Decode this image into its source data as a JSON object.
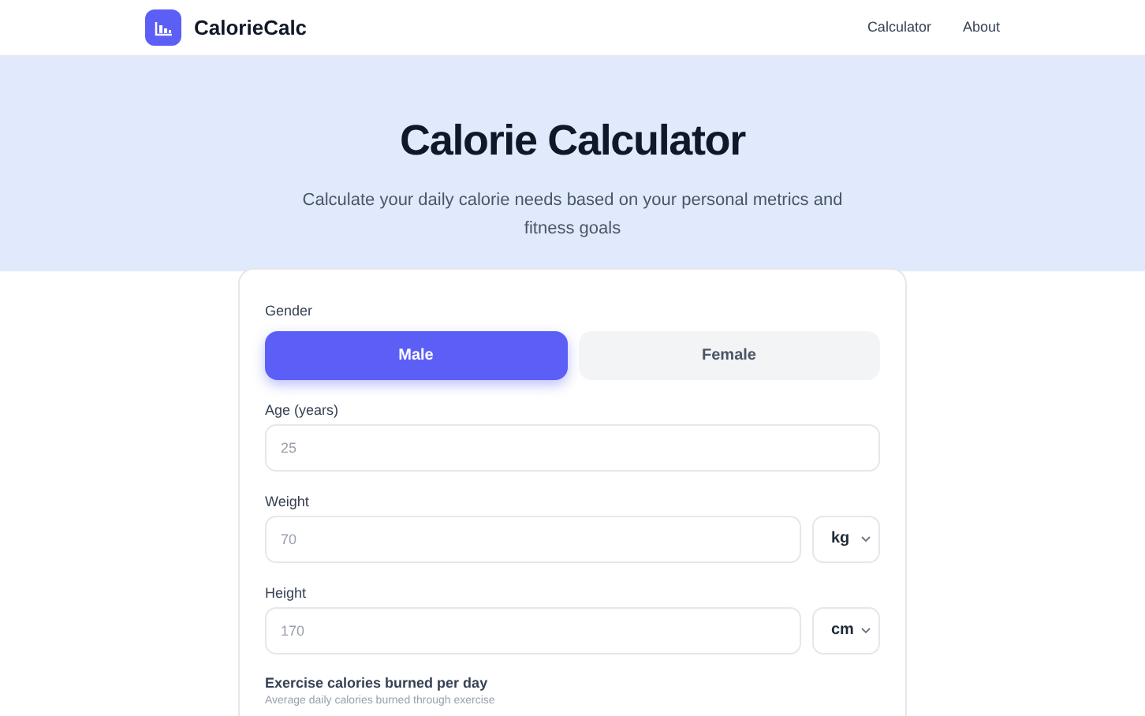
{
  "header": {
    "brand": "CalorieCalc",
    "nav": [
      {
        "label": "Calculator"
      },
      {
        "label": "About"
      }
    ]
  },
  "hero": {
    "title": "Calorie Calculator",
    "subtitle": "Calculate your daily calorie needs based on your personal metrics and fitness goals"
  },
  "form": {
    "gender": {
      "label": "Gender",
      "options": [
        {
          "label": "Male",
          "selected": true
        },
        {
          "label": "Female",
          "selected": false
        }
      ]
    },
    "fields": [
      {
        "kind": "plain",
        "label": "Age (years)",
        "placeholder": "25"
      },
      {
        "kind": "unit",
        "label": "Weight",
        "placeholder": "70",
        "unit": "kg"
      },
      {
        "kind": "unit",
        "label": "Height",
        "placeholder": "170",
        "unit": "cm"
      }
    ],
    "exercise": {
      "label": "Exercise calories burned per day",
      "hint": "Average daily calories burned through exercise"
    }
  }
}
